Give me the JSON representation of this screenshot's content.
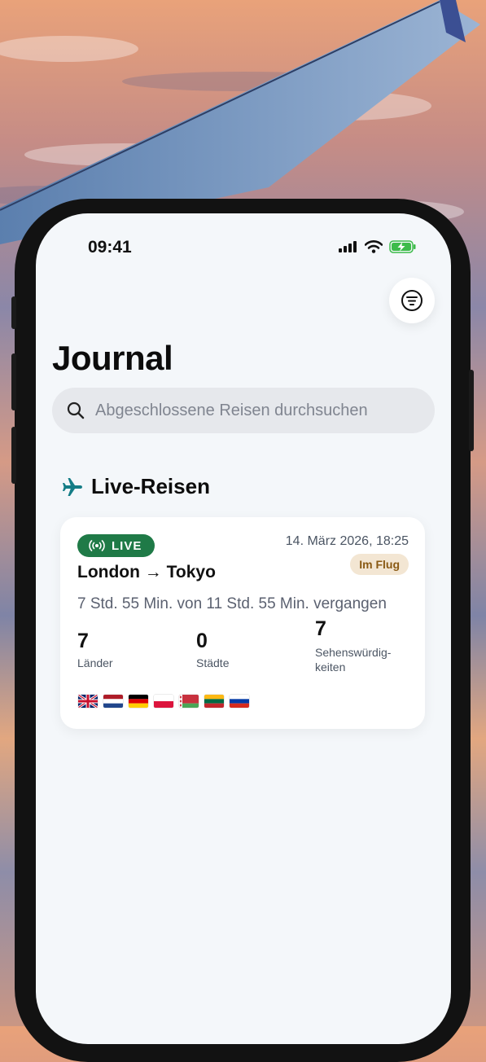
{
  "status_bar": {
    "time": "09:41"
  },
  "header": {
    "title": "Journal"
  },
  "search": {
    "placeholder": "Abgeschlossene Reisen durchsuchen"
  },
  "section": {
    "label": "Live-Reisen"
  },
  "trip": {
    "badge": "LIVE",
    "date": "14. März 2026, 18:25",
    "status": "Im Flug",
    "route": "London → Tokyo",
    "progress": "7 Std. 55 Min. von 11 Std. 55 Min. vergangen",
    "stats": [
      {
        "value": "7",
        "label": "Länder"
      },
      {
        "value": "0",
        "label": "Städte"
      },
      {
        "value": "7",
        "label": "Sehenswürdig-\nkeiten"
      }
    ],
    "flags": [
      "gb-flag-icon",
      "nl-flag-icon",
      "de-flag-icon",
      "pl-flag-icon",
      "by-flag-icon",
      "lt-flag-icon",
      "ru-flag-icon"
    ]
  },
  "colors": {
    "accent_teal": "#147d86",
    "live_green": "#1f7a47",
    "status_bg": "#f3e6d3",
    "status_text": "#8a5a14",
    "screen_bg": "#f4f7fa"
  }
}
